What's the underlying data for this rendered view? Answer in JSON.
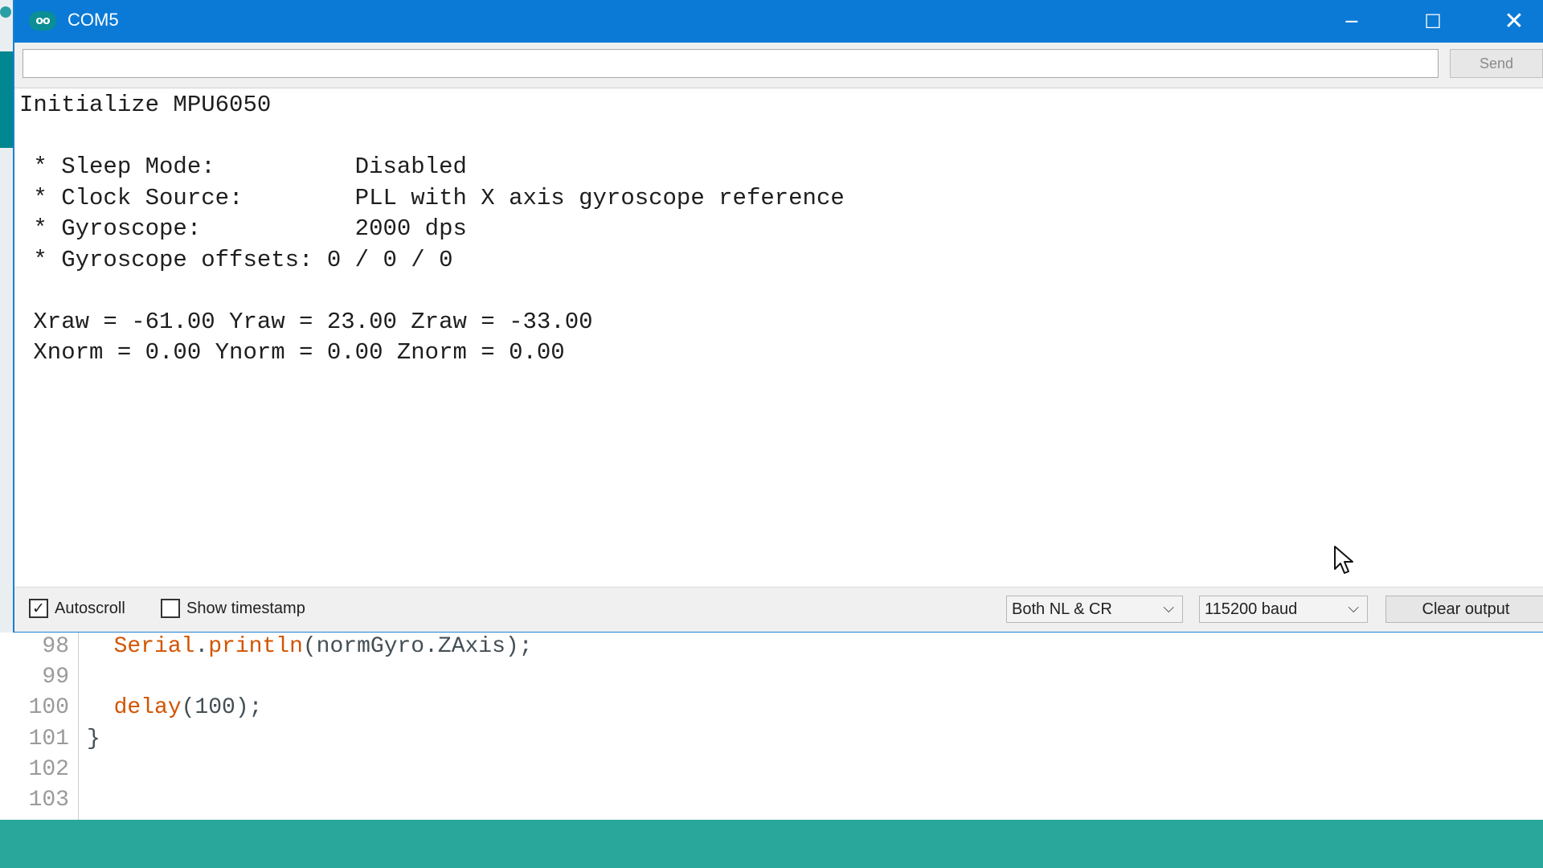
{
  "window": {
    "title": "COM5",
    "icon": "infinity-logo-icon",
    "app_icon_text": "oo",
    "controls": {
      "minimize": "─",
      "maximize": "☐",
      "close": "✕"
    }
  },
  "input_bar": {
    "value": "",
    "placeholder": "",
    "send_label": "Send"
  },
  "output_lines": [
    "Initialize MPU6050",
    "",
    " * Sleep Mode:          Disabled",
    " * Clock Source:        PLL with X axis gyroscope reference",
    " * Gyroscope:           2000 dps",
    " * Gyroscope offsets: 0 / 0 / 0",
    "",
    " Xraw = -61.00 Yraw = 23.00 Zraw = -33.00",
    " Xnorm = 0.00 Ynorm = 0.00 Znorm = 0.00"
  ],
  "status_bar": {
    "autoscroll": {
      "label": "Autoscroll",
      "checked": true,
      "mark": "✓"
    },
    "show_timestamp": {
      "label": "Show timestamp",
      "checked": false,
      "mark": ""
    },
    "line_ending": {
      "selected": "Both NL & CR",
      "chevron": "⌵"
    },
    "baud_rate": {
      "selected": "115200 baud",
      "chevron": "⌵"
    },
    "clear_label": "Clear output"
  },
  "editor": {
    "lines": [
      {
        "number": "98",
        "parts": [
          {
            "text": "  "
          },
          {
            "text": "Serial",
            "kw": true
          },
          {
            "text": "."
          },
          {
            "text": "println",
            "kw": true
          },
          {
            "text": "(normGyro.ZAxis);"
          }
        ]
      },
      {
        "number": "99",
        "parts": [
          {
            "text": ""
          }
        ]
      },
      {
        "number": "100",
        "parts": [
          {
            "text": "  "
          },
          {
            "text": "delay",
            "kw": true
          },
          {
            "text": "(100);"
          }
        ]
      },
      {
        "number": "101",
        "parts": [
          {
            "text": "}"
          }
        ]
      },
      {
        "number": "102",
        "parts": [
          {
            "text": ""
          }
        ]
      },
      {
        "number": "103",
        "parts": [
          {
            "text": ""
          }
        ]
      }
    ]
  },
  "colors": {
    "titlebar": "#0a7ad6",
    "keyword": "#d35400",
    "footer": "#28a79a"
  }
}
